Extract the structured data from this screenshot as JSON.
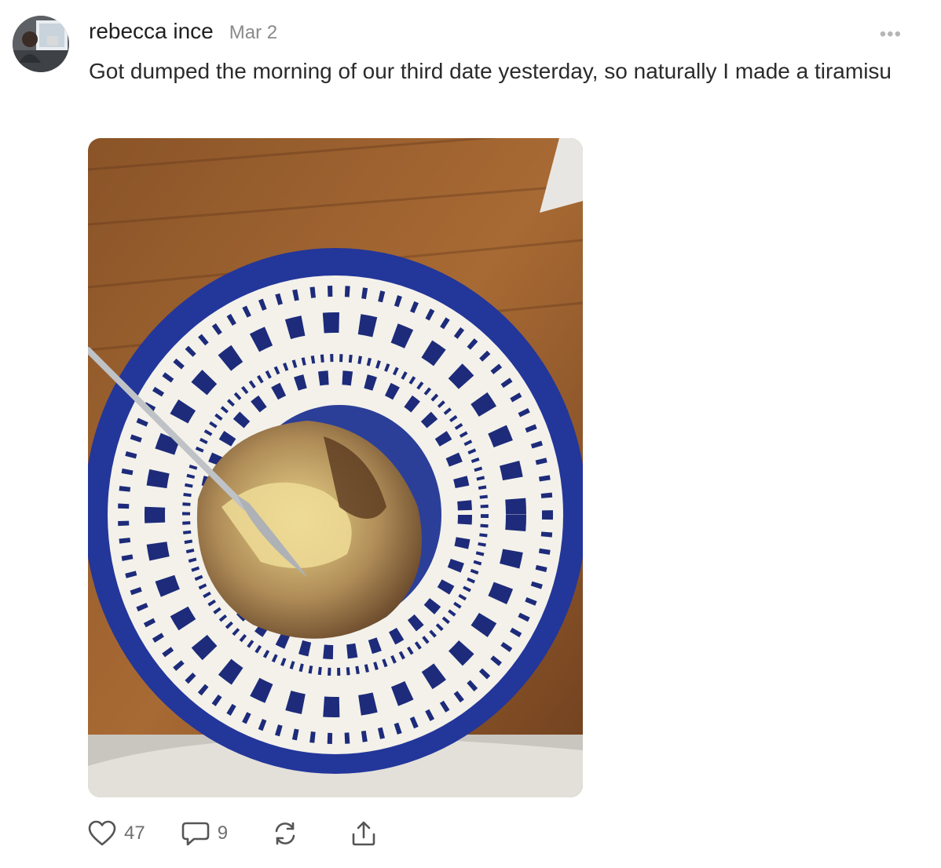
{
  "post": {
    "author": "rebecca ince",
    "date": "Mar 2",
    "text": "Got dumped the morning of our third date yesterday, so naturally I made a tiramisu",
    "more_label": "•••",
    "image_icon": "photo-of-tiramisu-in-blue-patterned-bowl"
  },
  "actions": {
    "like_count": "47",
    "comment_count": "9",
    "like_icon": "heart-icon",
    "comment_icon": "speech-bubble-icon",
    "restack_icon": "refresh-icon",
    "share_icon": "share-icon"
  }
}
